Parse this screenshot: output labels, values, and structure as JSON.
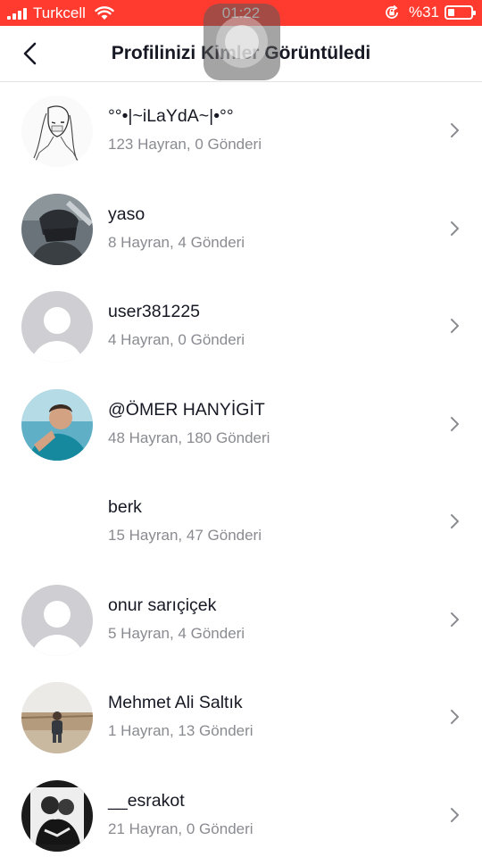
{
  "status_bar": {
    "carrier": "Turkcell",
    "time": "01:22",
    "battery_percent": "%31",
    "battery_level": 0.31,
    "bar_color": "#ff3b30"
  },
  "header": {
    "title": "Profilinizi Kimler Görüntüledi",
    "back_icon": "chevron-left-icon"
  },
  "viewers": [
    {
      "name": "°°•|~iLaYdA~|•°°",
      "stats": "123 Hayran, 0 Gönderi",
      "avatar": "sketch"
    },
    {
      "name": "yaso",
      "stats": "8 Hayran, 4 Gönderi",
      "avatar": "photo-dark"
    },
    {
      "name": "user381225",
      "stats": "4 Hayran, 0 Gönderi",
      "avatar": "placeholder"
    },
    {
      "name": "@ÖMER HANYİGİT",
      "stats": "48 Hayran, 180 Gönderi",
      "avatar": "photo-teal"
    },
    {
      "name": "berk",
      "stats": "15 Hayran, 47 Gönderi",
      "avatar": "none"
    },
    {
      "name": "onur sarıçiçek",
      "stats": "5 Hayran, 4 Gönderi",
      "avatar": "placeholder"
    },
    {
      "name": "Mehmet Ali Saltık",
      "stats": "1 Hayran, 13 Gönderi",
      "avatar": "photo-outdoor"
    },
    {
      "name": "__esrakot",
      "stats": "21 Hayran, 0 Gönderi",
      "avatar": "photo-bw"
    }
  ]
}
